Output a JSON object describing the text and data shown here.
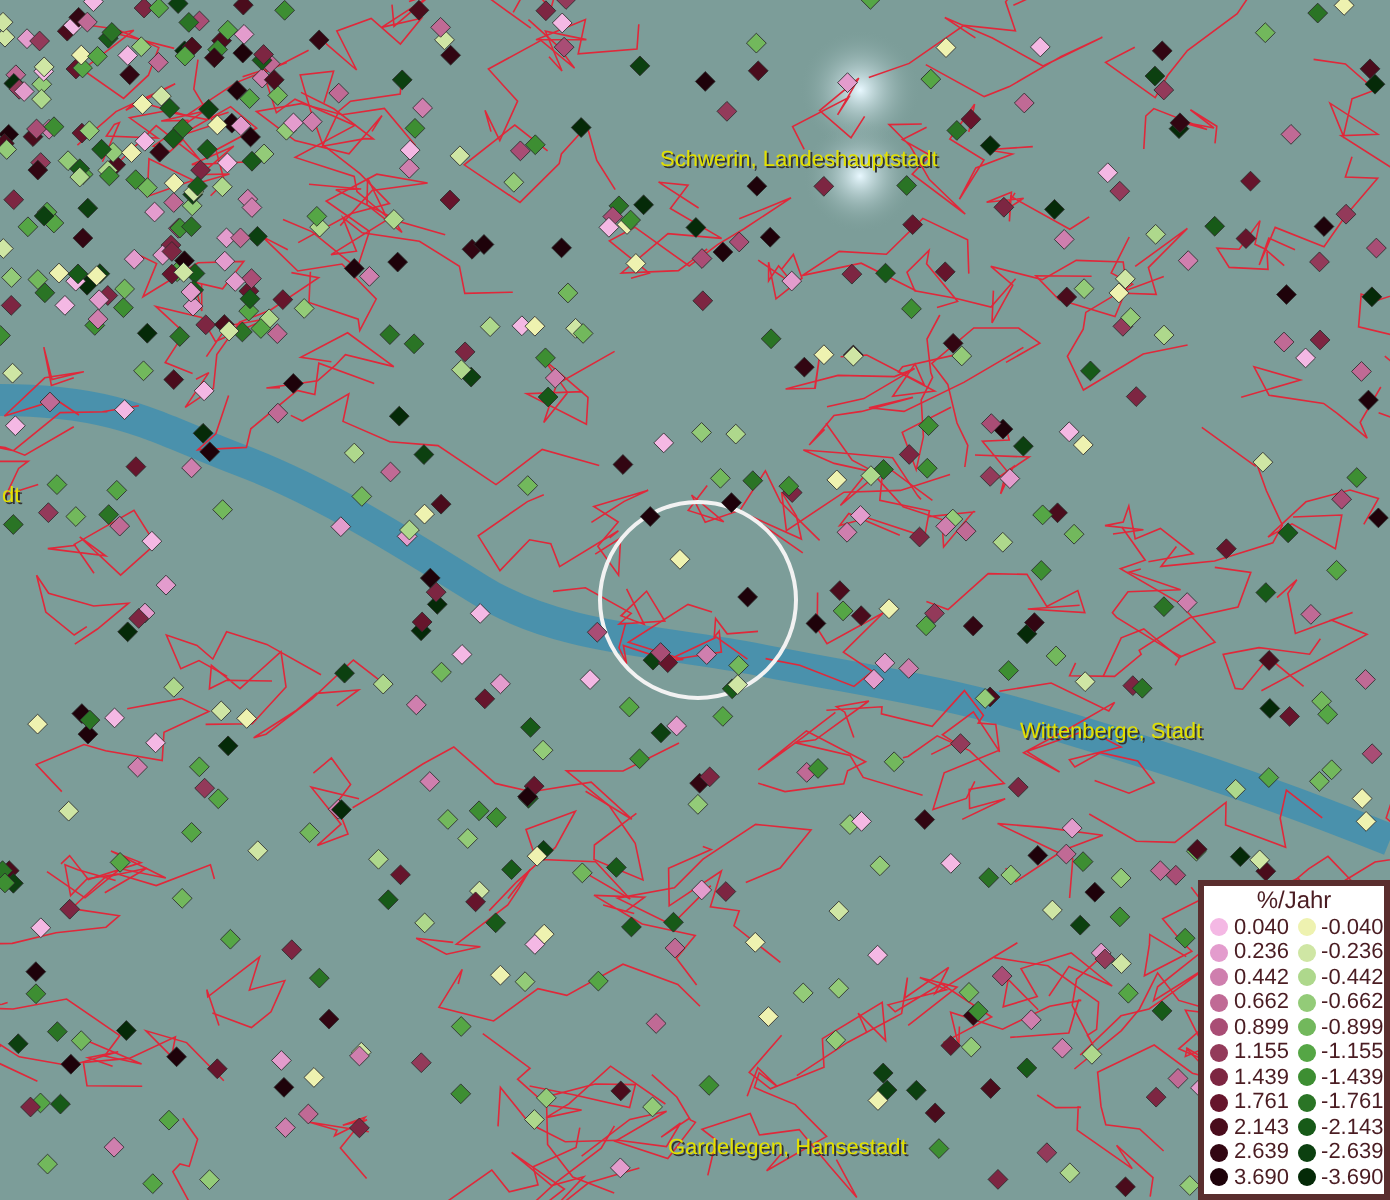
{
  "map": {
    "place_labels": [
      {
        "text": "Schwerin, Landeshauptstadt",
        "kind": "city"
      },
      {
        "text": "dt",
        "kind": "edge"
      },
      {
        "text": "Wittenberge, Stadt",
        "kind": "city"
      },
      {
        "text": "Gardelegen, Hansestadt",
        "kind": "city"
      }
    ]
  },
  "legend": {
    "title": "%/Jahr",
    "columns": [
      [
        {
          "label": "0.040",
          "color": "#f4b8e4"
        },
        {
          "label": "0.236",
          "color": "#e39ccd"
        },
        {
          "label": "0.442",
          "color": "#cf7fae"
        },
        {
          "label": "0.662",
          "color": "#c06a95"
        },
        {
          "label": "0.899",
          "color": "#a94d75"
        },
        {
          "label": "1.155",
          "color": "#933a5a"
        },
        {
          "label": "1.439",
          "color": "#7d2642"
        },
        {
          "label": "1.761",
          "color": "#66152c"
        },
        {
          "label": "2.143",
          "color": "#4a0c1c"
        },
        {
          "label": "2.639",
          "color": "#320612"
        },
        {
          "label": "3.690",
          "color": "#1e020a"
        }
      ],
      [
        {
          "label": "-0.040",
          "color": "#eef2b0"
        },
        {
          "label": "-0.236",
          "color": "#cfe6a4"
        },
        {
          "label": "-0.442",
          "color": "#aed88c"
        },
        {
          "label": "-0.662",
          "color": "#93cb78"
        },
        {
          "label": "-0.899",
          "color": "#72b85c"
        },
        {
          "label": "-1.155",
          "color": "#55a645"
        },
        {
          "label": "-1.439",
          "color": "#3d8e32"
        },
        {
          "label": "-1.761",
          "color": "#2a7425"
        },
        {
          "label": "-2.143",
          "color": "#175a18"
        },
        {
          "label": "-2.639",
          "color": "#0c4010"
        },
        {
          "label": "-3.690",
          "color": "#052a08"
        }
      ]
    ]
  }
}
